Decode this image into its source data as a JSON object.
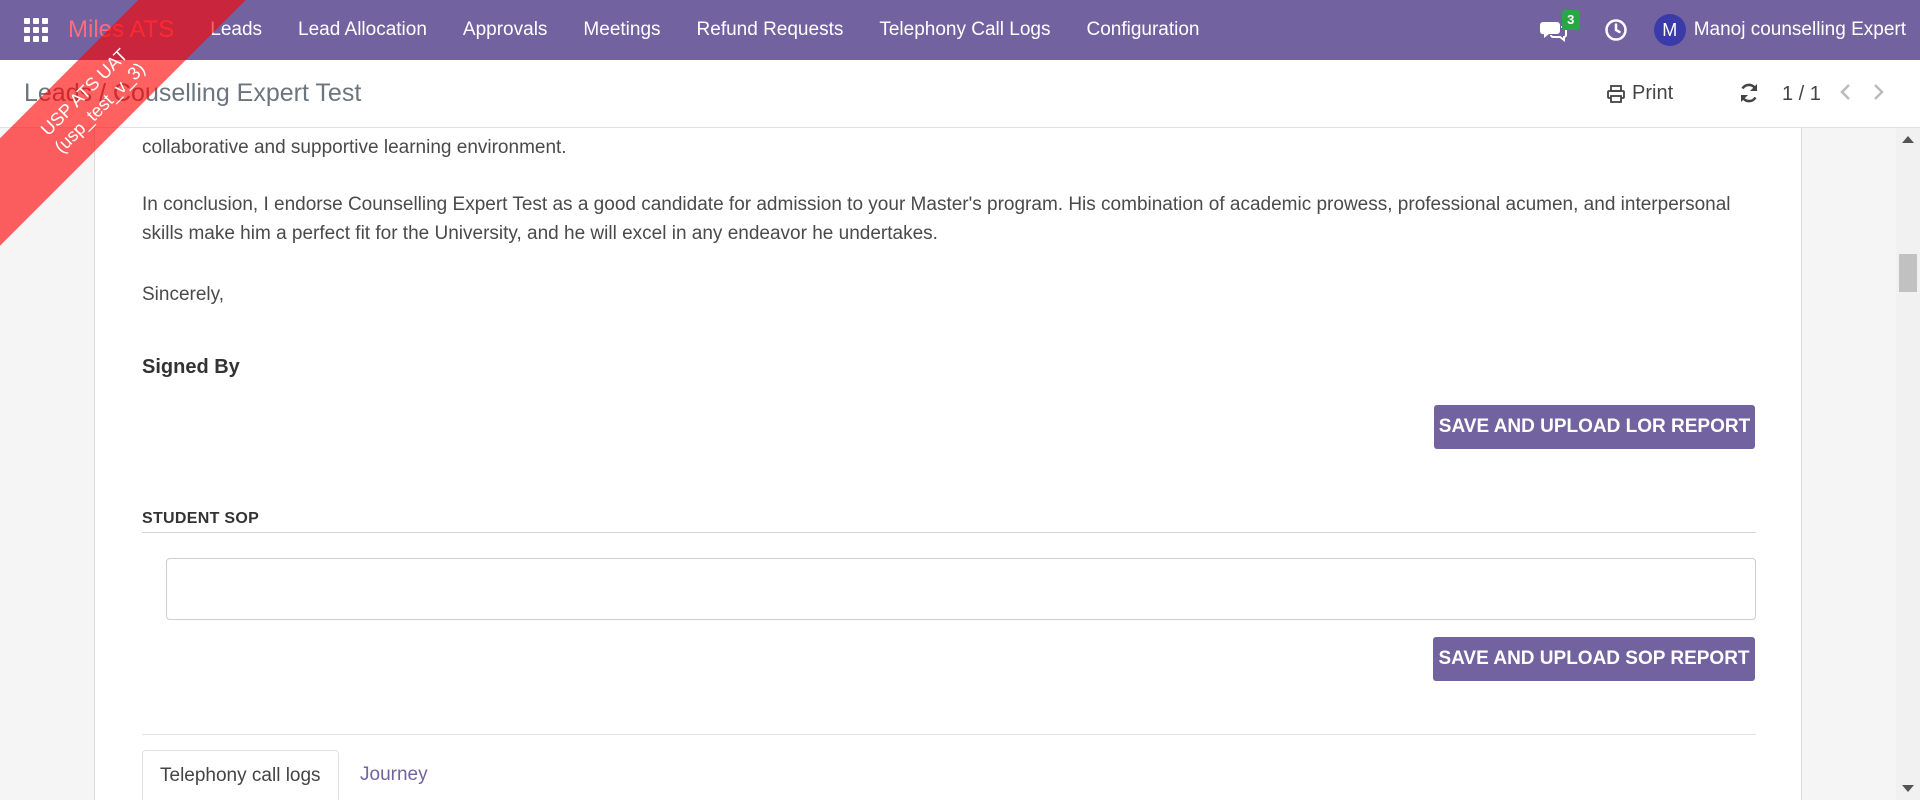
{
  "navbar": {
    "brand": "Miles ATS",
    "menu": [
      "Leads",
      "Lead Allocation",
      "Approvals",
      "Meetings",
      "Refund Requests",
      "Telephony Call Logs",
      "Configuration"
    ],
    "chat_icon": "chat-icon",
    "chat_badge": "3",
    "clock_icon": "clock-icon",
    "avatar_initial": "M",
    "user_name": "Manoj counselling Expert",
    "background": "#7263a0"
  },
  "ribbon": {
    "line1": "USP ATS UAT",
    "line2": "(usp_test_v_3)"
  },
  "breadcrumb": {
    "parent": "Leads",
    "separator": "/",
    "current": "Couselling Expert Test"
  },
  "control": {
    "print_label": "Print",
    "pager": "1 / 1"
  },
  "content": {
    "para_top": "collaborative and supportive learning environment.",
    "para_conclusion": "In conclusion, I endorse Counselling Expert Test as a good candidate for admission to your Master's program. His combination of academic prowess, professional acumen, and interpersonal skills make him a perfect fit for the University, and he will excel in any endeavor he undertakes.",
    "sincerely": "Sincerely,",
    "signed_by": "Signed By",
    "lor_button": "SAVE AND UPLOAD LOR REPORT",
    "sop_section_title": "STUDENT SOP",
    "sop_value": "",
    "sop_button": "SAVE AND UPLOAD SOP REPORT"
  },
  "tabs": [
    {
      "label": "Telephony call logs",
      "active": true
    },
    {
      "label": "Journey",
      "active": false
    }
  ]
}
